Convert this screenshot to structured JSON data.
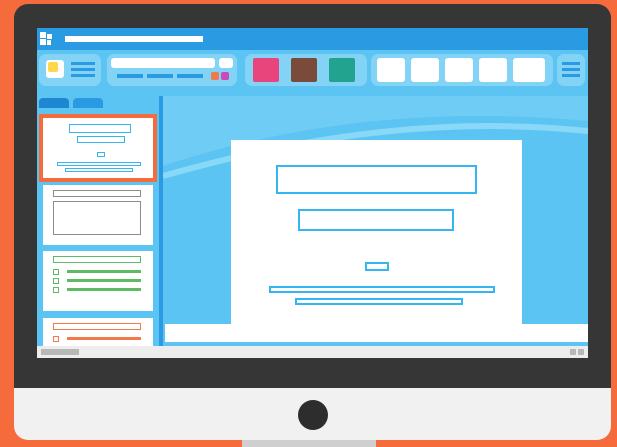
{
  "device": {
    "type": "desktop-monitor"
  },
  "app": {
    "window_title": "",
    "icons": {
      "logo": "app-grid-logo",
      "menu": "hamburger-menu-icon"
    }
  },
  "ribbon": {
    "swatch_colors": [
      "#E8457C",
      "#7A4A3A",
      "#21A390"
    ],
    "accent_colors": [
      "#F07A4A",
      "#C94BB5"
    ]
  },
  "slides_panel": {
    "thumbnail_count": 4,
    "selected_index": 0
  },
  "colors": {
    "frame": "#F56B3C",
    "bezel": "#363636",
    "screen": "#5BC4F3",
    "titlebar": "#2A9AE3",
    "placeholder_border": "#34B7F1",
    "list_accent": "#5DBB63"
  }
}
